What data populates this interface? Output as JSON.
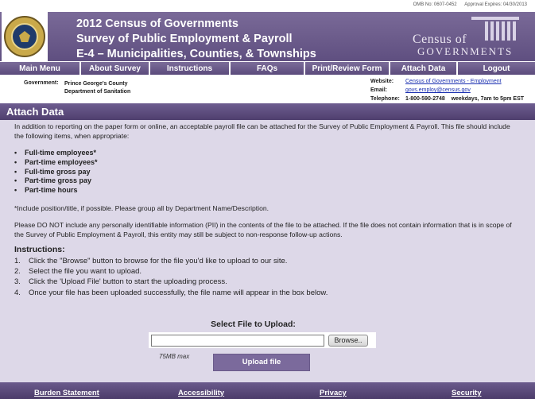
{
  "omb": {
    "number": "OMB No: 0607-0452",
    "expires": "Approval Expires: 04/30/2013"
  },
  "header": {
    "title_lines": [
      "2012 Census of Governments",
      "Survey of Public Employment & Payroll",
      "E-4 – Municipalities, Counties, & Townships"
    ],
    "brand_line1": "Census of",
    "brand_line2": "GOVERNMENTS",
    "seal_icon": "department-of-commerce-seal-icon"
  },
  "nav": {
    "items": [
      {
        "label": "Main Menu"
      },
      {
        "label": "About Survey"
      },
      {
        "label": "Instructions"
      },
      {
        "label": "FAQs"
      },
      {
        "label": "Print/Review Form"
      },
      {
        "label": "Attach Data"
      },
      {
        "label": "Logout"
      }
    ]
  },
  "info": {
    "government_label": "Government:",
    "government_name": "Prince George's County",
    "government_dept": "Department of Sanitation",
    "website_label": "Website:",
    "website_value": "Census of Governments - Employment",
    "email_label": "Email:",
    "email_value": "govs.employ@census.gov",
    "telephone_label": "Telephone:",
    "telephone_value": "1-800-590-2748    weekdays, 7am to 5pm EST"
  },
  "section": {
    "title": "Attach Data"
  },
  "content": {
    "intro": "In addition to reporting on the paper form or online, an acceptable payroll file can be attached for the Survey of Public Employment & Payroll. This file should include the following items, when appropriate:",
    "items": [
      "Full-time employees*",
      "Part-time employees*",
      "Full-time gross pay",
      "Part-time gross pay",
      "Part-time hours"
    ],
    "footnote": "*Include position/title, if possible. Please group all by Department Name/Description.",
    "pii_notice": "Please DO NOT include any personally identifiable information (PII) in the contents of the file to be attached. If the file does not contain information that is in scope of the Survey of Public Employment & Payroll, this entity may still be subject to non-response follow-up actions.",
    "instructions_heading": "Instructions:",
    "steps": [
      {
        "num": "1.",
        "text": "Click the \"Browse\" button to browse for the file you'd like to upload to our site."
      },
      {
        "num": "2.",
        "text": "Select the file you want to upload."
      },
      {
        "num": "3.",
        "text": "Click the 'Upload File' button to start the uploading process."
      },
      {
        "num": "4.",
        "text": "Once your file has been uploaded successfully, the file name will appear in the box below."
      }
    ]
  },
  "upload": {
    "label": "Select File to Upload:",
    "file_value": "",
    "browse_label": "Browse..",
    "max_size": "75MB max",
    "button_label": "Upload file"
  },
  "footer": {
    "links": [
      {
        "label": "Burden Statement"
      },
      {
        "label": "Accessibility"
      },
      {
        "label": "Privacy"
      },
      {
        "label": "Security"
      }
    ]
  },
  "colors": {
    "header_purple": "#6a5a8a",
    "content_lavender": "#ddd8e8",
    "link_blue": "#1a2fb0"
  }
}
